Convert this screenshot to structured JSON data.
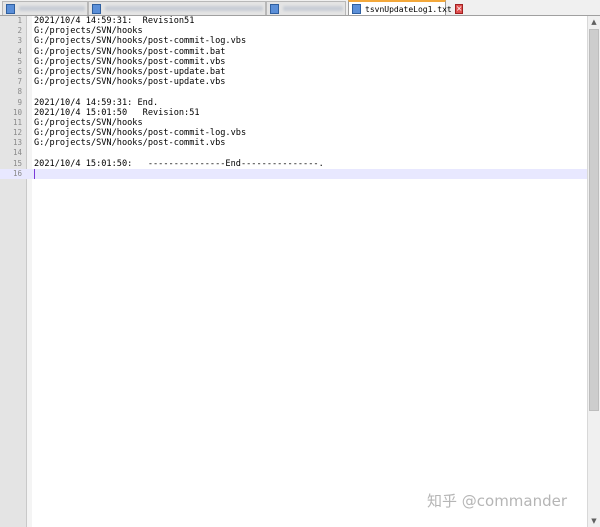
{
  "tabs": [
    {
      "label": "",
      "active": false
    },
    {
      "label": "",
      "active": false
    },
    {
      "label": "",
      "active": false
    },
    {
      "label": "tsvnUpdateLog1.txt",
      "active": true
    }
  ],
  "icons": {
    "file": "file-icon",
    "close": "close-icon",
    "scroll_up": "scroll-up-arrow-icon",
    "scroll_down": "scroll-down-arrow-icon"
  },
  "colors": {
    "active_tab_accent": "#f3a83b",
    "current_line": "#e8e8ff",
    "caret": "#7a3bd8"
  },
  "editor": {
    "current_line": 16,
    "lines": [
      {
        "num": "1",
        "text": "2021/10/4 14:59:31:  Revision51"
      },
      {
        "num": "2",
        "text": "G:/projects/SVN/hooks"
      },
      {
        "num": "3",
        "text": "G:/projects/SVN/hooks/post-commit-log.vbs"
      },
      {
        "num": "4",
        "text": "G:/projects/SVN/hooks/post-commit.bat"
      },
      {
        "num": "5",
        "text": "G:/projects/SVN/hooks/post-commit.vbs"
      },
      {
        "num": "6",
        "text": "G:/projects/SVN/hooks/post-update.bat"
      },
      {
        "num": "7",
        "text": "G:/projects/SVN/hooks/post-update.vbs"
      },
      {
        "num": "8",
        "text": ""
      },
      {
        "num": "9",
        "text": "2021/10/4 14:59:31: End."
      },
      {
        "num": "10",
        "text": "2021/10/4 15:01:50   Revision:51"
      },
      {
        "num": "11",
        "text": "G:/projects/SVN/hooks"
      },
      {
        "num": "12",
        "text": "G:/projects/SVN/hooks/post-commit-log.vbs"
      },
      {
        "num": "13",
        "text": "G:/projects/SVN/hooks/post-commit.vbs"
      },
      {
        "num": "14",
        "text": ""
      },
      {
        "num": "15",
        "text": "2021/10/4 15:01:50:   ---------------End---------------."
      },
      {
        "num": "16",
        "text": ""
      }
    ]
  },
  "watermark": "知乎 @commander"
}
